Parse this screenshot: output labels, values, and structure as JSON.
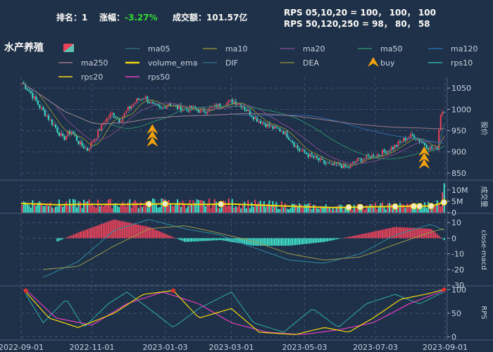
{
  "header": {
    "rank_label": "排名：",
    "rank_value": "1",
    "change_label": "涨幅：",
    "change_value": "-3.27%",
    "turnover_label": "成交额：",
    "turnover_value": "101.57亿",
    "rps_line1": "RPS 05,10,20 = 100， 100， 100",
    "rps_line2": "RPS 50,120,250 = 98， 80， 58"
  },
  "title": "水产养殖",
  "legend": [
    {
      "label": "",
      "kind": "candle",
      "color": "#e8435a"
    },
    {
      "label": "ma05",
      "kind": "line",
      "color": "#2c6d7e"
    },
    {
      "label": "ma10",
      "kind": "line",
      "color": "#8a8a3a"
    },
    {
      "label": "ma20",
      "kind": "line",
      "color": "#7a4a8a"
    },
    {
      "label": "ma50",
      "kind": "line",
      "color": "#2e8a6a"
    },
    {
      "label": "ma120",
      "kind": "line",
      "color": "#2e6aa8"
    },
    {
      "label": "ma250",
      "kind": "line",
      "color": "#9a7a8a"
    },
    {
      "label": "volume_ema",
      "kind": "line",
      "color": "#f5d90a"
    },
    {
      "label": "DIF",
      "kind": "line",
      "color": "#2c6d7e"
    },
    {
      "label": "DEA",
      "kind": "line",
      "color": "#8a8a3a"
    },
    {
      "label": "buy",
      "kind": "marker",
      "color": "#f5a20a"
    },
    {
      "label": "rps10",
      "kind": "line",
      "color": "#2fb0a0"
    },
    {
      "label": "rps20",
      "kind": "line",
      "color": "#f5d90a"
    },
    {
      "label": "rps50",
      "kind": "line",
      "color": "#e040c0"
    }
  ],
  "colors": {
    "up": "#e8435a",
    "down": "#40e0c8",
    "grid": "#3c5070",
    "axis": "#9fb0c4"
  },
  "chart_data": [
    {
      "type": "candlestick",
      "ylabel": "股价",
      "ylim": [
        835,
        1075
      ],
      "yticks": [
        850,
        900,
        950,
        1000,
        1050
      ],
      "x_start": "2022-09-01",
      "x_end": "2023-09-01",
      "close_path": [
        {
          "x": "2022-09-01",
          "y": 1065
        },
        {
          "x": "2022-09-09",
          "y": 1040
        },
        {
          "x": "2022-09-16",
          "y": 1010
        },
        {
          "x": "2022-09-23",
          "y": 985
        },
        {
          "x": "2022-09-30",
          "y": 960
        },
        {
          "x": "2022-10-07",
          "y": 930
        },
        {
          "x": "2022-10-14",
          "y": 950
        },
        {
          "x": "2022-10-21",
          "y": 920
        },
        {
          "x": "2022-10-28",
          "y": 905
        },
        {
          "x": "2022-11-04",
          "y": 935
        },
        {
          "x": "2022-11-11",
          "y": 970
        },
        {
          "x": "2022-11-18",
          "y": 990
        },
        {
          "x": "2022-11-25",
          "y": 975
        },
        {
          "x": "2022-12-02",
          "y": 1000
        },
        {
          "x": "2022-12-09",
          "y": 1020
        },
        {
          "x": "2022-12-16",
          "y": 1030
        },
        {
          "x": "2022-12-23",
          "y": 1010
        },
        {
          "x": "2022-12-30",
          "y": 1000
        },
        {
          "x": "2023-01-06",
          "y": 1015
        },
        {
          "x": "2023-01-13",
          "y": 1005
        },
        {
          "x": "2023-01-20",
          "y": 1000
        },
        {
          "x": "2023-01-27",
          "y": 1002
        },
        {
          "x": "2023-02-03",
          "y": 995
        },
        {
          "x": "2023-02-10",
          "y": 1000
        },
        {
          "x": "2023-02-17",
          "y": 1008
        },
        {
          "x": "2023-02-24",
          "y": 1015
        },
        {
          "x": "2023-03-03",
          "y": 1020
        },
        {
          "x": "2023-03-10",
          "y": 1010
        },
        {
          "x": "2023-03-17",
          "y": 990
        },
        {
          "x": "2023-03-24",
          "y": 975
        },
        {
          "x": "2023-03-31",
          "y": 965
        },
        {
          "x": "2023-04-07",
          "y": 955
        },
        {
          "x": "2023-04-14",
          "y": 950
        },
        {
          "x": "2023-04-21",
          "y": 930
        },
        {
          "x": "2023-04-28",
          "y": 905
        },
        {
          "x": "2023-05-05",
          "y": 895
        },
        {
          "x": "2023-05-12",
          "y": 885
        },
        {
          "x": "2023-05-19",
          "y": 875
        },
        {
          "x": "2023-05-26",
          "y": 868
        },
        {
          "x": "2023-06-02",
          "y": 870
        },
        {
          "x": "2023-06-09",
          "y": 862
        },
        {
          "x": "2023-06-16",
          "y": 878
        },
        {
          "x": "2023-06-23",
          "y": 885
        },
        {
          "x": "2023-06-30",
          "y": 890
        },
        {
          "x": "2023-07-07",
          "y": 895
        },
        {
          "x": "2023-07-14",
          "y": 905
        },
        {
          "x": "2023-07-21",
          "y": 915
        },
        {
          "x": "2023-07-28",
          "y": 930
        },
        {
          "x": "2023-08-04",
          "y": 938
        },
        {
          "x": "2023-08-11",
          "y": 925
        },
        {
          "x": "2023-08-18",
          "y": 910
        },
        {
          "x": "2023-08-25",
          "y": 905
        },
        {
          "x": "2023-08-28",
          "y": 990
        },
        {
          "x": "2023-08-31",
          "y": 1000
        }
      ],
      "buy_signals": [
        {
          "x": "2022-12-23",
          "y": 952
        },
        {
          "x": "2023-08-14",
          "y": 900
        }
      ]
    },
    {
      "type": "bar",
      "ylabel": "成交量",
      "ylim": [
        0,
        14
      ],
      "yticks": [
        {
          "v": 0,
          "label": "0"
        },
        {
          "v": 5,
          "label": "5M"
        },
        {
          "v": 10,
          "label": "10M"
        }
      ],
      "volume_path": [
        {
          "x": "2022-09-01",
          "y": 4
        },
        {
          "x": "2022-09-15",
          "y": 3.8
        },
        {
          "x": "2022-10-01",
          "y": 3.5
        },
        {
          "x": "2022-10-20",
          "y": 3.6
        },
        {
          "x": "2022-11-10",
          "y": 3.7
        },
        {
          "x": "2022-12-01",
          "y": 3.6
        },
        {
          "x": "2023-01-01",
          "y": 3.9
        },
        {
          "x": "2023-02-01",
          "y": 3.6
        },
        {
          "x": "2023-03-01",
          "y": 3.8
        },
        {
          "x": "2023-04-01",
          "y": 3.2
        },
        {
          "x": "2023-05-01",
          "y": 2.6
        },
        {
          "x": "2023-06-01",
          "y": 2.2
        },
        {
          "x": "2023-07-01",
          "y": 2.6
        },
        {
          "x": "2023-08-01",
          "y": 2.8
        },
        {
          "x": "2023-08-20",
          "y": 2.9
        },
        {
          "x": "2023-08-31",
          "y": 4.5
        }
      ],
      "spike": {
        "x": "2023-08-31",
        "y": 13
      }
    },
    {
      "type": "line",
      "ylabel": "close-macd",
      "ylim": [
        -30,
        15
      ],
      "yticks": [
        -30,
        -20,
        -10,
        0,
        10
      ],
      "dif_path": [
        {
          "x": "2022-09-20",
          "y": -25
        },
        {
          "x": "2022-10-20",
          "y": -15
        },
        {
          "x": "2022-11-20",
          "y": 5
        },
        {
          "x": "2022-12-20",
          "y": 12
        },
        {
          "x": "2023-01-20",
          "y": 6
        },
        {
          "x": "2023-02-20",
          "y": 2
        },
        {
          "x": "2023-03-20",
          "y": -6
        },
        {
          "x": "2023-04-20",
          "y": -14
        },
        {
          "x": "2023-05-20",
          "y": -16
        },
        {
          "x": "2023-06-20",
          "y": -10
        },
        {
          "x": "2023-07-20",
          "y": 2
        },
        {
          "x": "2023-08-20",
          "y": 9
        },
        {
          "x": "2023-08-31",
          "y": 5
        }
      ],
      "dea_path": [
        {
          "x": "2022-09-20",
          "y": -20
        },
        {
          "x": "2022-10-20",
          "y": -18
        },
        {
          "x": "2022-11-20",
          "y": -5
        },
        {
          "x": "2022-12-20",
          "y": 6
        },
        {
          "x": "2023-01-20",
          "y": 8
        },
        {
          "x": "2023-02-20",
          "y": 3
        },
        {
          "x": "2023-03-20",
          "y": -2
        },
        {
          "x": "2023-04-20",
          "y": -10
        },
        {
          "x": "2023-05-20",
          "y": -14
        },
        {
          "x": "2023-06-20",
          "y": -12
        },
        {
          "x": "2023-07-20",
          "y": -4
        },
        {
          "x": "2023-08-20",
          "y": 4
        },
        {
          "x": "2023-08-31",
          "y": 6
        }
      ]
    },
    {
      "type": "line",
      "ylabel": "RPS",
      "ylim": [
        -5,
        108
      ],
      "yticks": [
        0,
        50,
        100
      ],
      "rps10_path": [
        {
          "x": "2022-09-05",
          "y": 90
        },
        {
          "x": "2022-09-20",
          "y": 30
        },
        {
          "x": "2022-10-10",
          "y": 80
        },
        {
          "x": "2022-10-25",
          "y": 20
        },
        {
          "x": "2022-11-15",
          "y": 70
        },
        {
          "x": "2022-12-01",
          "y": 95
        },
        {
          "x": "2022-12-20",
          "y": 60
        },
        {
          "x": "2023-01-10",
          "y": 20
        },
        {
          "x": "2023-02-01",
          "y": 60
        },
        {
          "x": "2023-03-01",
          "y": 95
        },
        {
          "x": "2023-03-20",
          "y": 30
        },
        {
          "x": "2023-04-15",
          "y": 10
        },
        {
          "x": "2023-05-10",
          "y": 60
        },
        {
          "x": "2023-06-01",
          "y": 20
        },
        {
          "x": "2023-06-25",
          "y": 70
        },
        {
          "x": "2023-07-20",
          "y": 90
        },
        {
          "x": "2023-08-10",
          "y": 70
        },
        {
          "x": "2023-08-31",
          "y": 95
        }
      ],
      "rps20_path": [
        {
          "x": "2022-09-05",
          "y": 95
        },
        {
          "x": "2022-09-25",
          "y": 40
        },
        {
          "x": "2022-10-20",
          "y": 20
        },
        {
          "x": "2022-11-20",
          "y": 50
        },
        {
          "x": "2022-12-15",
          "y": 90
        },
        {
          "x": "2023-01-10",
          "y": 98
        },
        {
          "x": "2023-02-01",
          "y": 40
        },
        {
          "x": "2023-03-01",
          "y": 60
        },
        {
          "x": "2023-03-25",
          "y": 10
        },
        {
          "x": "2023-04-25",
          "y": 5
        },
        {
          "x": "2023-05-20",
          "y": 20
        },
        {
          "x": "2023-06-10",
          "y": 10
        },
        {
          "x": "2023-07-01",
          "y": 40
        },
        {
          "x": "2023-07-25",
          "y": 80
        },
        {
          "x": "2023-08-15",
          "y": 90
        },
        {
          "x": "2023-08-31",
          "y": 100
        }
      ],
      "rps50_path": [
        {
          "x": "2022-09-05",
          "y": 100
        },
        {
          "x": "2022-10-01",
          "y": 40
        },
        {
          "x": "2022-11-01",
          "y": 25
        },
        {
          "x": "2022-12-01",
          "y": 70
        },
        {
          "x": "2023-01-01",
          "y": 95
        },
        {
          "x": "2023-02-01",
          "y": 70
        },
        {
          "x": "2023-03-01",
          "y": 30
        },
        {
          "x": "2023-04-01",
          "y": 10
        },
        {
          "x": "2023-05-01",
          "y": 5
        },
        {
          "x": "2023-06-01",
          "y": 15
        },
        {
          "x": "2023-07-01",
          "y": 30
        },
        {
          "x": "2023-08-01",
          "y": 70
        },
        {
          "x": "2023-08-31",
          "y": 98
        }
      ]
    }
  ],
  "x_ticks": [
    "2022-09-01",
    "2022-11-01",
    "2023-01-03",
    "2023-03-01",
    "2023-05-03",
    "2023-07-03",
    "2023-09-01"
  ]
}
